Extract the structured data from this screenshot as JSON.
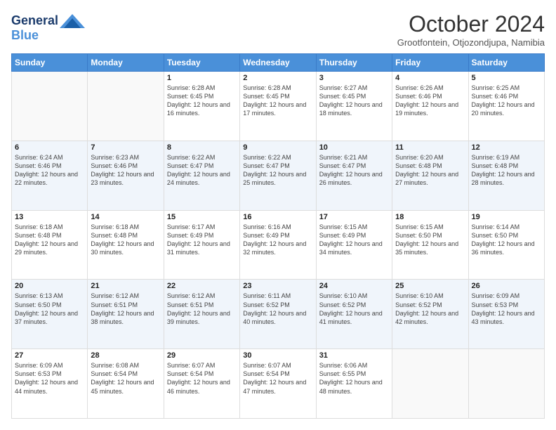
{
  "header": {
    "logo_line1": "General",
    "logo_line2": "Blue",
    "month_title": "October 2024",
    "location": "Grootfontein, Otjozondjupa, Namibia"
  },
  "days_of_week": [
    "Sunday",
    "Monday",
    "Tuesday",
    "Wednesday",
    "Thursday",
    "Friday",
    "Saturday"
  ],
  "weeks": [
    [
      {
        "day": "",
        "info": ""
      },
      {
        "day": "",
        "info": ""
      },
      {
        "day": "1",
        "info": "Sunrise: 6:28 AM\nSunset: 6:45 PM\nDaylight: 12 hours and 16 minutes."
      },
      {
        "day": "2",
        "info": "Sunrise: 6:28 AM\nSunset: 6:45 PM\nDaylight: 12 hours and 17 minutes."
      },
      {
        "day": "3",
        "info": "Sunrise: 6:27 AM\nSunset: 6:45 PM\nDaylight: 12 hours and 18 minutes."
      },
      {
        "day": "4",
        "info": "Sunrise: 6:26 AM\nSunset: 6:46 PM\nDaylight: 12 hours and 19 minutes."
      },
      {
        "day": "5",
        "info": "Sunrise: 6:25 AM\nSunset: 6:46 PM\nDaylight: 12 hours and 20 minutes."
      }
    ],
    [
      {
        "day": "6",
        "info": "Sunrise: 6:24 AM\nSunset: 6:46 PM\nDaylight: 12 hours and 22 minutes."
      },
      {
        "day": "7",
        "info": "Sunrise: 6:23 AM\nSunset: 6:46 PM\nDaylight: 12 hours and 23 minutes."
      },
      {
        "day": "8",
        "info": "Sunrise: 6:22 AM\nSunset: 6:47 PM\nDaylight: 12 hours and 24 minutes."
      },
      {
        "day": "9",
        "info": "Sunrise: 6:22 AM\nSunset: 6:47 PM\nDaylight: 12 hours and 25 minutes."
      },
      {
        "day": "10",
        "info": "Sunrise: 6:21 AM\nSunset: 6:47 PM\nDaylight: 12 hours and 26 minutes."
      },
      {
        "day": "11",
        "info": "Sunrise: 6:20 AM\nSunset: 6:48 PM\nDaylight: 12 hours and 27 minutes."
      },
      {
        "day": "12",
        "info": "Sunrise: 6:19 AM\nSunset: 6:48 PM\nDaylight: 12 hours and 28 minutes."
      }
    ],
    [
      {
        "day": "13",
        "info": "Sunrise: 6:18 AM\nSunset: 6:48 PM\nDaylight: 12 hours and 29 minutes."
      },
      {
        "day": "14",
        "info": "Sunrise: 6:18 AM\nSunset: 6:48 PM\nDaylight: 12 hours and 30 minutes."
      },
      {
        "day": "15",
        "info": "Sunrise: 6:17 AM\nSunset: 6:49 PM\nDaylight: 12 hours and 31 minutes."
      },
      {
        "day": "16",
        "info": "Sunrise: 6:16 AM\nSunset: 6:49 PM\nDaylight: 12 hours and 32 minutes."
      },
      {
        "day": "17",
        "info": "Sunrise: 6:15 AM\nSunset: 6:49 PM\nDaylight: 12 hours and 34 minutes."
      },
      {
        "day": "18",
        "info": "Sunrise: 6:15 AM\nSunset: 6:50 PM\nDaylight: 12 hours and 35 minutes."
      },
      {
        "day": "19",
        "info": "Sunrise: 6:14 AM\nSunset: 6:50 PM\nDaylight: 12 hours and 36 minutes."
      }
    ],
    [
      {
        "day": "20",
        "info": "Sunrise: 6:13 AM\nSunset: 6:50 PM\nDaylight: 12 hours and 37 minutes."
      },
      {
        "day": "21",
        "info": "Sunrise: 6:12 AM\nSunset: 6:51 PM\nDaylight: 12 hours and 38 minutes."
      },
      {
        "day": "22",
        "info": "Sunrise: 6:12 AM\nSunset: 6:51 PM\nDaylight: 12 hours and 39 minutes."
      },
      {
        "day": "23",
        "info": "Sunrise: 6:11 AM\nSunset: 6:52 PM\nDaylight: 12 hours and 40 minutes."
      },
      {
        "day": "24",
        "info": "Sunrise: 6:10 AM\nSunset: 6:52 PM\nDaylight: 12 hours and 41 minutes."
      },
      {
        "day": "25",
        "info": "Sunrise: 6:10 AM\nSunset: 6:52 PM\nDaylight: 12 hours and 42 minutes."
      },
      {
        "day": "26",
        "info": "Sunrise: 6:09 AM\nSunset: 6:53 PM\nDaylight: 12 hours and 43 minutes."
      }
    ],
    [
      {
        "day": "27",
        "info": "Sunrise: 6:09 AM\nSunset: 6:53 PM\nDaylight: 12 hours and 44 minutes."
      },
      {
        "day": "28",
        "info": "Sunrise: 6:08 AM\nSunset: 6:54 PM\nDaylight: 12 hours and 45 minutes."
      },
      {
        "day": "29",
        "info": "Sunrise: 6:07 AM\nSunset: 6:54 PM\nDaylight: 12 hours and 46 minutes."
      },
      {
        "day": "30",
        "info": "Sunrise: 6:07 AM\nSunset: 6:54 PM\nDaylight: 12 hours and 47 minutes."
      },
      {
        "day": "31",
        "info": "Sunrise: 6:06 AM\nSunset: 6:55 PM\nDaylight: 12 hours and 48 minutes."
      },
      {
        "day": "",
        "info": ""
      },
      {
        "day": "",
        "info": ""
      }
    ]
  ]
}
